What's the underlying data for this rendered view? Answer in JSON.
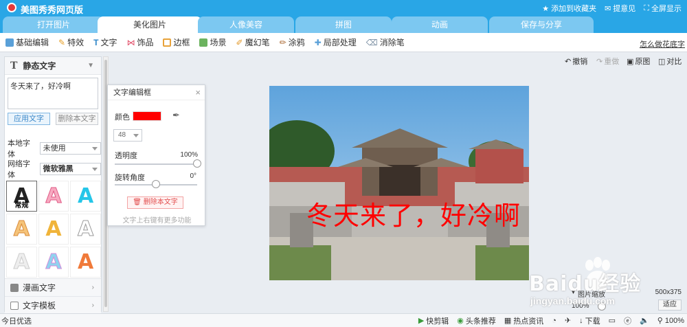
{
  "app": {
    "title": "美图秀秀网页版",
    "links": [
      "添加到收藏夹",
      "提意见",
      "全屏显示"
    ]
  },
  "tabs": [
    {
      "label": "打开图片"
    },
    {
      "label": "美化图片",
      "active": true
    },
    {
      "label": "人像美容"
    },
    {
      "label": "拼图"
    },
    {
      "label": "动画"
    },
    {
      "label": "保存与分享"
    }
  ],
  "toolbar": {
    "items": [
      "基础编辑",
      "特效",
      "文字",
      "饰品",
      "边框",
      "场景",
      "魔幻笔",
      "涂鸦",
      "局部处理",
      "消除笔"
    ],
    "help": "怎么做花底字"
  },
  "left_panel": {
    "title": "静态文字",
    "text_value": "冬天来了，好冷啊",
    "apply_label": "应用文字",
    "delete_label": "删除本文字",
    "local_font_label": "本地字体",
    "local_font_value": "未使用",
    "web_font_label": "网络字体",
    "web_font_value": "微软雅黑",
    "style_first_label": "常规",
    "comic_text": "漫画文字",
    "text_template": "文字模板"
  },
  "edit_box": {
    "title": "文字编辑框",
    "color_label": "颜色",
    "color_value": "#ff0000",
    "size_value": "48",
    "opacity_label": "透明度",
    "opacity_value": "100%",
    "rotation_label": "旋转角度",
    "rotation_value": "0°",
    "delete_label": "删除本文字",
    "hint": "文字上右键有更多功能"
  },
  "right_tools": {
    "undo": "撤销",
    "redo": "重做",
    "original": "原图",
    "compare": "对比"
  },
  "canvas": {
    "overlay_text": "冬天来了，好冷啊",
    "dimensions": "500x375"
  },
  "zoom": {
    "label": "图片缩放",
    "value": "100%",
    "fit": "适应"
  },
  "statusbar": {
    "left": "今日优选",
    "items": [
      "快剪辑",
      "头条推荐",
      "热点资讯",
      "下载"
    ],
    "zoom": "100%"
  },
  "watermark": {
    "brand": "Baidu经验",
    "url": "jingyan.baidu.com"
  }
}
